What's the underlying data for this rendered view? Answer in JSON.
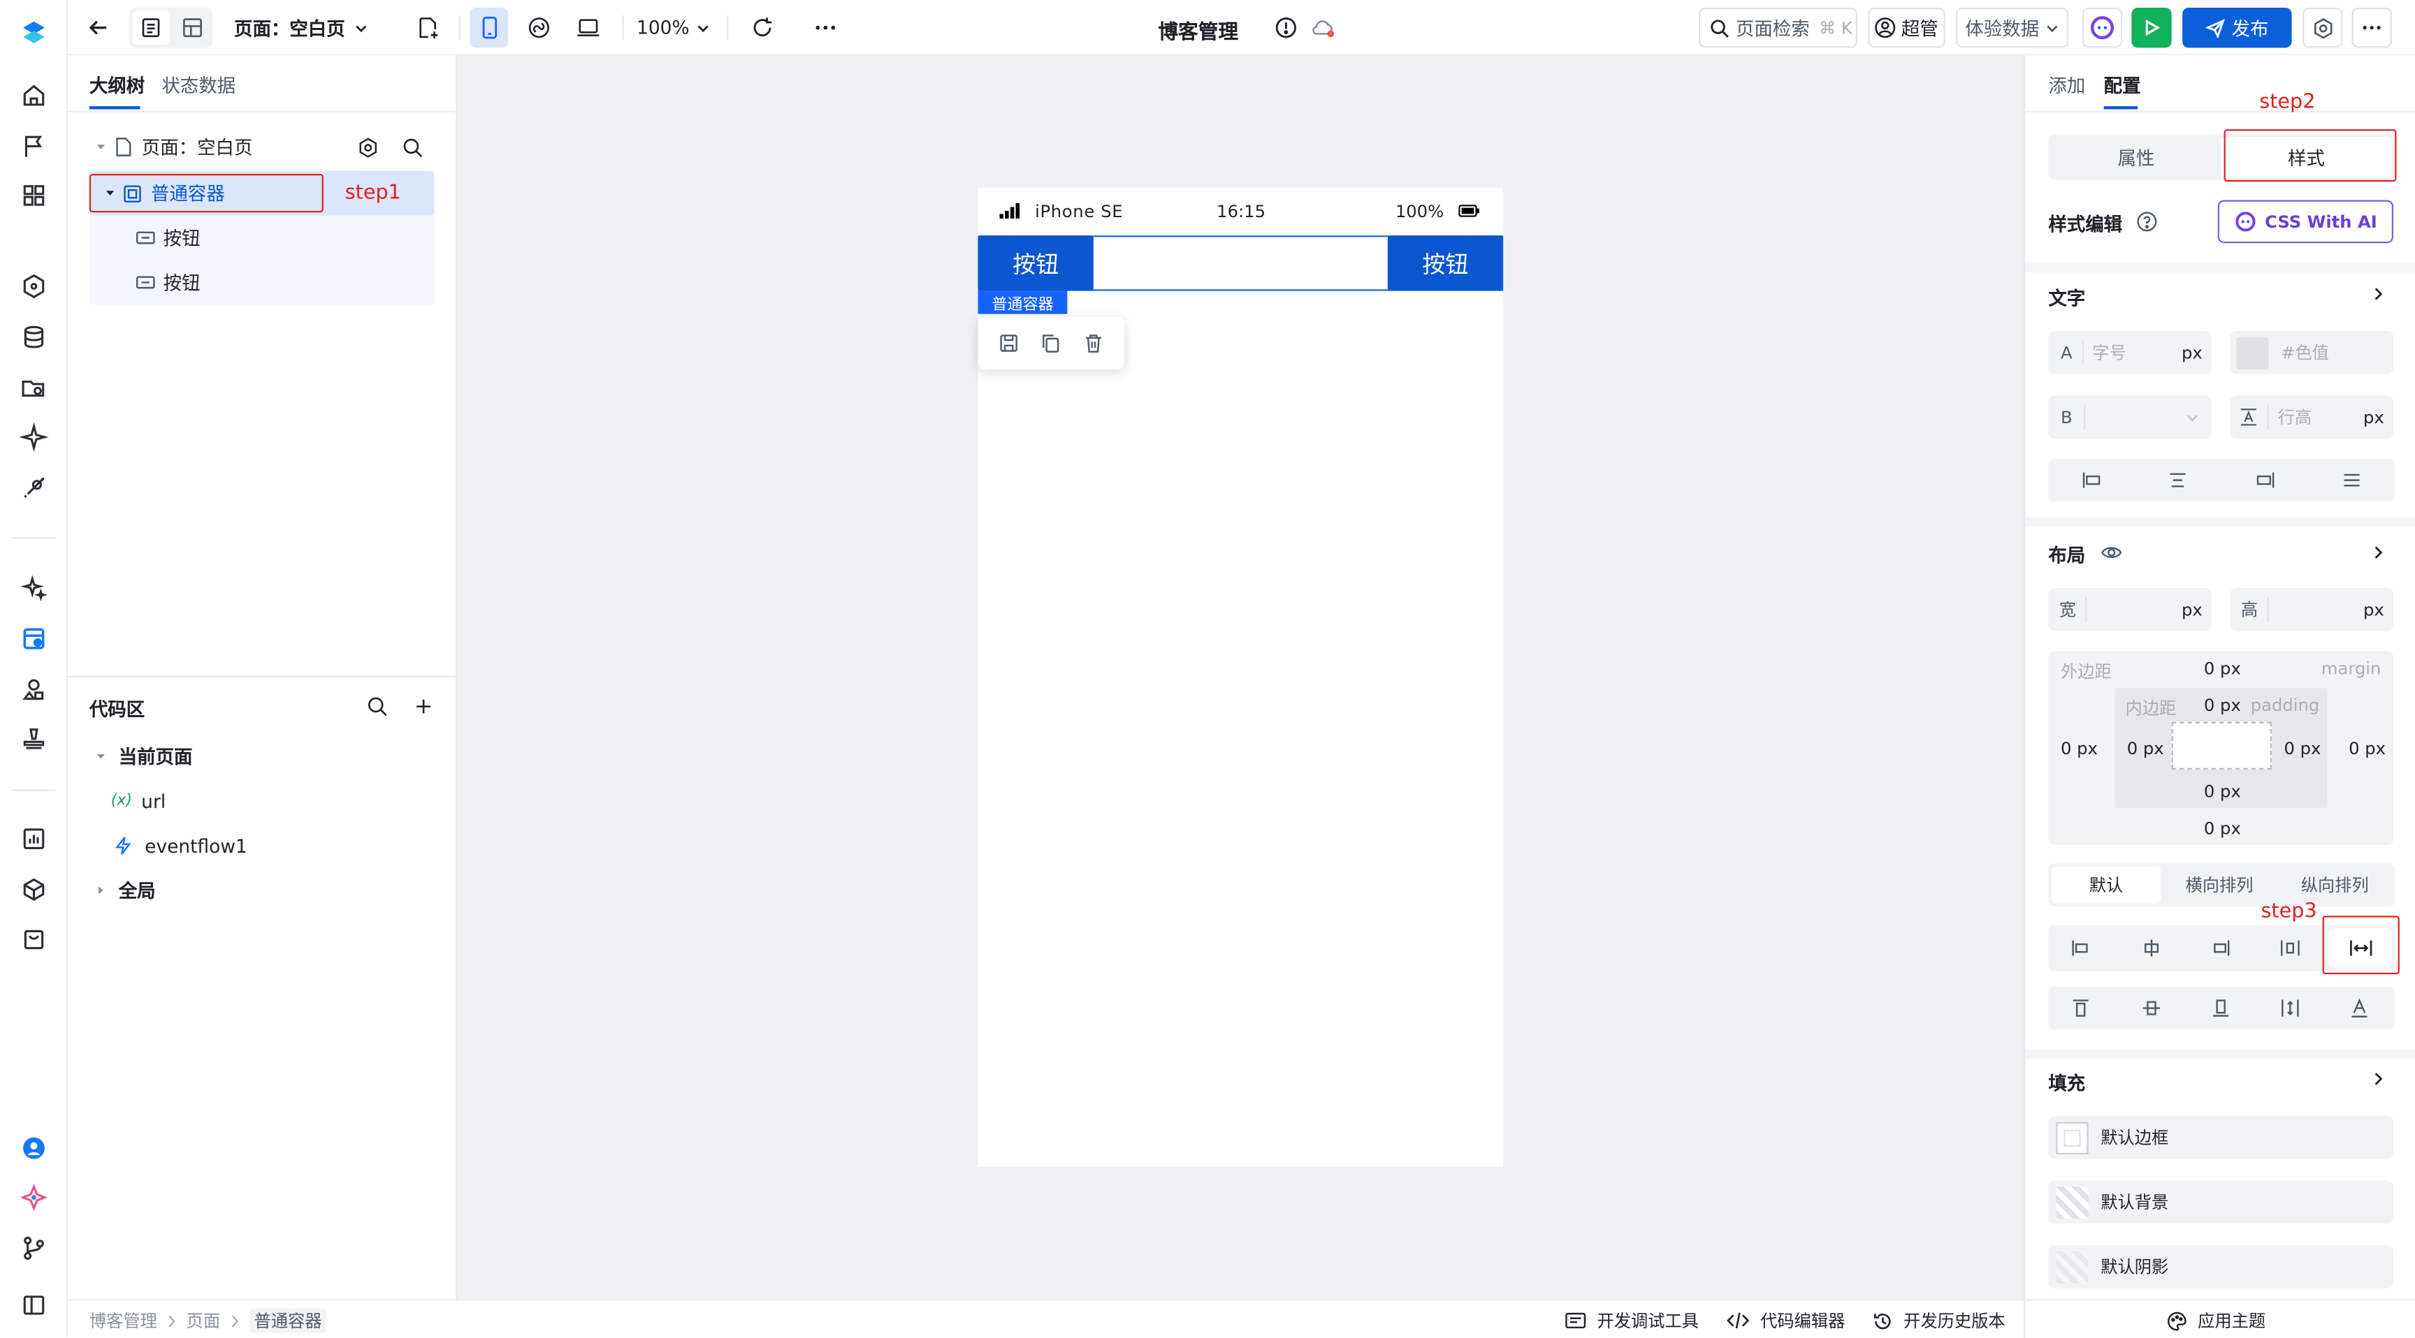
{
  "topbar": {
    "page_selector": "页面：空白页",
    "zoom": "100%",
    "app_title": "博客管理",
    "search_label": "页面检索",
    "search_shortcut": "⌘ K",
    "user": "超管",
    "env_select": "体验数据",
    "publish": "发布"
  },
  "left_panel": {
    "tabs": [
      "大纲树",
      "状态数据"
    ],
    "tree": {
      "page": "页面：空白页",
      "container": "普通容器",
      "children": [
        "按钮",
        "按钮"
      ]
    },
    "code_area": {
      "title": "代码区",
      "current_page": "当前页面",
      "items": [
        "url",
        "eventflow1"
      ],
      "global": "全局",
      "var_badge": "(x)"
    }
  },
  "canvas": {
    "status_bar": {
      "device": "iPhone SE",
      "time": "16:15",
      "battery": "100%"
    },
    "buttons": [
      "按钮",
      "按钮"
    ],
    "selected_label": "普通容器"
  },
  "right_panel": {
    "tabs": [
      "添加",
      "配置"
    ],
    "mode_tabs": [
      "属性",
      "样式"
    ],
    "style_edit": "样式编辑",
    "css_ai": "CSS With AI",
    "text_section": {
      "title": "文字",
      "font_size_prefix": "A",
      "font_size_placeholder": "字号",
      "unit": "px",
      "color_placeholder": "#色值",
      "weight_prefix": "B",
      "line_height_placeholder": "行高"
    },
    "layout_section": {
      "title": "布局",
      "width_label": "宽",
      "height_label": "高",
      "unit": "px",
      "margin_cn": "外边距",
      "margin_en": "margin",
      "padding_cn": "内边距",
      "padding_en": "padding",
      "margin_top": "0 px",
      "margin_left": "0 px",
      "margin_right": "0 px",
      "margin_bottom": "0 px",
      "padding_top": "0 px",
      "padding_left": "0 px",
      "padding_right": "0 px",
      "padding_bottom": "0 px",
      "direction_tabs": [
        "默认",
        "横向排列",
        "纵向排列"
      ]
    },
    "fill_section": {
      "title": "填充",
      "items": [
        "默认边框",
        "默认背景",
        "默认阴影"
      ]
    }
  },
  "bottom_bar": {
    "breadcrumb": [
      "博客管理",
      "页面",
      "普通容器"
    ],
    "tools": [
      "开发调试工具",
      "代码编辑器",
      "开发历史版本"
    ],
    "theme": "应用主题"
  },
  "annotations": {
    "step1": "step1",
    "step2": "step2",
    "step3": "step3"
  },
  "colors": {
    "primary": "#0b57d0",
    "publish": "#0d5fd9",
    "run": "#12b25d",
    "annotation": "#e02020"
  }
}
